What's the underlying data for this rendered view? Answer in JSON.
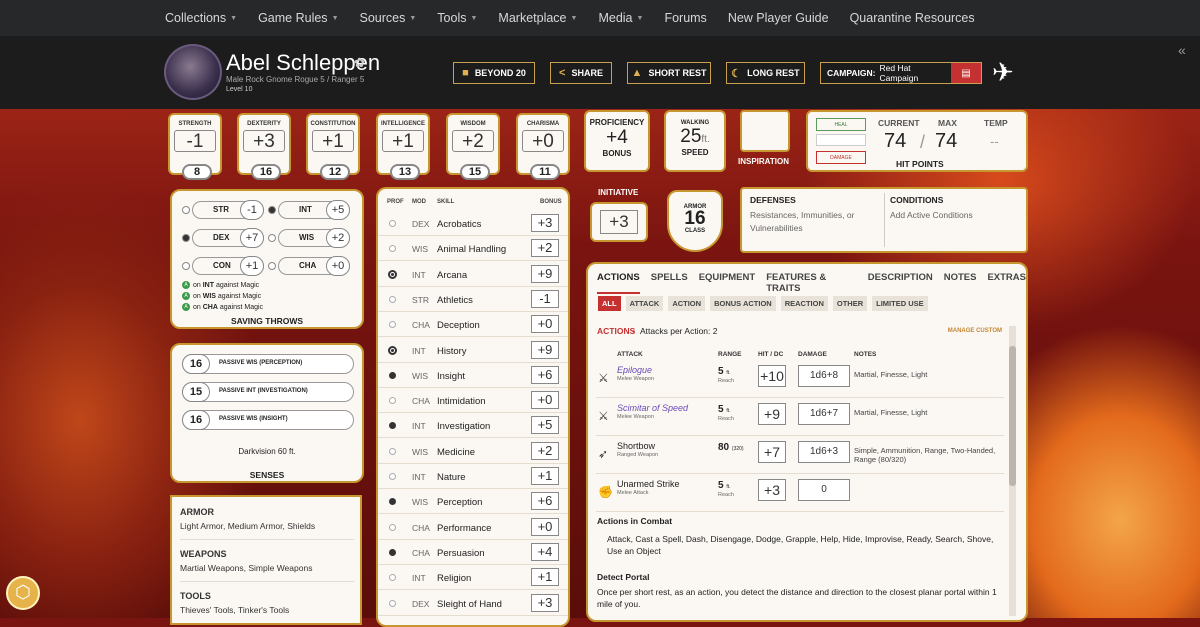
{
  "nav": [
    "Collections",
    "Game Rules",
    "Sources",
    "Tools",
    "Marketplace",
    "Media",
    "Forums",
    "New Player Guide",
    "Quarantine Resources"
  ],
  "nav_caret": [
    true,
    true,
    true,
    true,
    true,
    true,
    false,
    false,
    false
  ],
  "character": {
    "name": "Abel Schleppen",
    "subtitle": "Male  Rock Gnome  Rogue 5 / Ranger 5",
    "level": "Level 10"
  },
  "header_buttons": {
    "beyond20": "BEYOND 20",
    "share": "SHARE",
    "short_rest": "SHORT REST",
    "long_rest": "LONG REST"
  },
  "campaign": {
    "label": "CAMPAIGN:",
    "value": "Red Hat Campaign"
  },
  "abilities": [
    {
      "name": "STRENGTH",
      "mod": "-1",
      "score": "8"
    },
    {
      "name": "DEXTERITY",
      "mod": "+3",
      "score": "16"
    },
    {
      "name": "CONSTITUTION",
      "mod": "+1",
      "score": "12"
    },
    {
      "name": "INTELLIGENCE",
      "mod": "+1",
      "score": "13"
    },
    {
      "name": "WISDOM",
      "mod": "+2",
      "score": "15"
    },
    {
      "name": "CHARISMA",
      "mod": "+0",
      "score": "11"
    }
  ],
  "proficiency": {
    "label": "PROFICIENCY",
    "value": "+4",
    "sub": "BONUS"
  },
  "speed": {
    "label": "WALKING",
    "value": "25",
    "unit": "ft.",
    "sub": "SPEED"
  },
  "inspiration": "INSPIRATION",
  "hp": {
    "heal": "HEAL",
    "damage": "DAMAGE",
    "current_label": "CURRENT",
    "max_label": "MAX",
    "temp_label": "TEMP",
    "current": "74",
    "max": "74",
    "temp": "--",
    "title": "HIT POINTS"
  },
  "saves": [
    {
      "abbr": "STR",
      "val": "-1",
      "prof": false
    },
    {
      "abbr": "INT",
      "val": "+5",
      "prof": true
    },
    {
      "abbr": "DEX",
      "val": "+7",
      "prof": true
    },
    {
      "abbr": "WIS",
      "val": "+2",
      "prof": false
    },
    {
      "abbr": "CON",
      "val": "+1",
      "prof": false
    },
    {
      "abbr": "CHA",
      "val": "+0",
      "prof": false
    }
  ],
  "save_adv": [
    {
      "pre": "on ",
      "stat": "INT",
      "post": " against Magic"
    },
    {
      "pre": "on ",
      "stat": "WIS",
      "post": " against Magic"
    },
    {
      "pre": "on ",
      "stat": "CHA",
      "post": " against Magic"
    }
  ],
  "saving_throws_title": "SAVING THROWS",
  "senses": [
    {
      "val": "16",
      "label": "PASSIVE WIS (PERCEPTION)"
    },
    {
      "val": "15",
      "label": "PASSIVE INT (INVESTIGATION)"
    },
    {
      "val": "16",
      "label": "PASSIVE WIS (INSIGHT)"
    }
  ],
  "darkvision": "Darkvision 60 ft.",
  "senses_title": "SENSES",
  "proficiencies": [
    {
      "head": "ARMOR",
      "text": "Light Armor, Medium Armor, Shields"
    },
    {
      "head": "WEAPONS",
      "text": "Martial Weapons, Simple Weapons"
    },
    {
      "head": "TOOLS",
      "text": "Thieves' Tools, Tinker's Tools"
    }
  ],
  "skills_header": {
    "prof": "PROF",
    "mod": "MOD",
    "skill": "SKILL",
    "bonus": "BONUS"
  },
  "skills": [
    {
      "mod": "DEX",
      "name": "Acrobatics",
      "bonus": "+3",
      "prof": "none"
    },
    {
      "mod": "WIS",
      "name": "Animal Handling",
      "bonus": "+2",
      "prof": "none"
    },
    {
      "mod": "INT",
      "name": "Arcana",
      "bonus": "+9",
      "prof": "expert"
    },
    {
      "mod": "STR",
      "name": "Athletics",
      "bonus": "-1",
      "prof": "none"
    },
    {
      "mod": "CHA",
      "name": "Deception",
      "bonus": "+0",
      "prof": "none"
    },
    {
      "mod": "INT",
      "name": "History",
      "bonus": "+9",
      "prof": "expert"
    },
    {
      "mod": "WIS",
      "name": "Insight",
      "bonus": "+6",
      "prof": "prof"
    },
    {
      "mod": "CHA",
      "name": "Intimidation",
      "bonus": "+0",
      "prof": "none"
    },
    {
      "mod": "INT",
      "name": "Investigation",
      "bonus": "+5",
      "prof": "prof"
    },
    {
      "mod": "WIS",
      "name": "Medicine",
      "bonus": "+2",
      "prof": "none"
    },
    {
      "mod": "INT",
      "name": "Nature",
      "bonus": "+1",
      "prof": "none"
    },
    {
      "mod": "WIS",
      "name": "Perception",
      "bonus": "+6",
      "prof": "prof"
    },
    {
      "mod": "CHA",
      "name": "Performance",
      "bonus": "+0",
      "prof": "none"
    },
    {
      "mod": "CHA",
      "name": "Persuasion",
      "bonus": "+4",
      "prof": "prof"
    },
    {
      "mod": "INT",
      "name": "Religion",
      "bonus": "+1",
      "prof": "none"
    },
    {
      "mod": "DEX",
      "name": "Sleight of Hand",
      "bonus": "+3",
      "prof": "none"
    }
  ],
  "initiative": {
    "label": "INITIATIVE",
    "value": "+3"
  },
  "armor_class": {
    "top": "ARMOR",
    "value": "16",
    "bottom": "CLASS"
  },
  "defenses": {
    "title": "DEFENSES",
    "text": "Resistances, Immunities, or Vulnerabilities"
  },
  "conditions": {
    "title": "CONDITIONS",
    "text": "Add Active Conditions"
  },
  "tabs": [
    "ACTIONS",
    "SPELLS",
    "EQUIPMENT",
    "FEATURES & TRAITS",
    "DESCRIPTION",
    "NOTES",
    "EXTRAS"
  ],
  "subtabs": [
    "ALL",
    "ATTACK",
    "ACTION",
    "BONUS ACTION",
    "REACTION",
    "OTHER",
    "LIMITED USE"
  ],
  "actions_header": {
    "label": "ACTIONS",
    "sep": "•",
    "text": "Attacks per Action: 2",
    "manage": "MANAGE CUSTOM"
  },
  "attack_cols": {
    "attack": "ATTACK",
    "range": "RANGE",
    "hit": "HIT / DC",
    "damage": "DAMAGE",
    "notes": "NOTES"
  },
  "attacks": [
    {
      "name": "Epilogue",
      "type": "Melee Weapon",
      "range": "5",
      "unit": "ft.",
      "range_sub": "Reach",
      "hit": "+10",
      "damage": "1d6+8",
      "notes": "Martial, Finesse, Light",
      "magic": true,
      "icon": "⚔"
    },
    {
      "name": "Scimitar of Speed",
      "type": "Melee Weapon",
      "range": "5",
      "unit": "ft.",
      "range_sub": "Reach",
      "hit": "+9",
      "damage": "1d6+7",
      "notes": "Martial, Finesse, Light",
      "magic": true,
      "icon": "⚔"
    },
    {
      "name": "Shortbow",
      "type": "Ranged Weapon",
      "range": "80",
      "unit": "(320)",
      "range_sub": "",
      "hit": "+7",
      "damage": "1d6+3",
      "notes": "Simple, Ammunition, Range, Two-Handed, Range (80/320)",
      "magic": false,
      "icon": "➶"
    },
    {
      "name": "Unarmed Strike",
      "type": "Melee Attack",
      "range": "5",
      "unit": "ft.",
      "range_sub": "Reach",
      "hit": "+3",
      "damage": "0",
      "notes": "",
      "magic": false,
      "icon": "✊"
    }
  ],
  "combat": {
    "title": "Actions in Combat",
    "text": "Attack, Cast a Spell, Dash, Disengage, Dodge, Grapple, Help, Hide, Improvise, Ready, Search, Shove, Use an Object"
  },
  "portal": {
    "title": "Detect Portal",
    "text": "Once per short rest, as an action, you detect the distance and direction to the closest planar portal within 1 mile of you."
  },
  "colors": {
    "accent": "#c53131",
    "border": "#c6962f",
    "parchment": "#fbf8f3",
    "nav": "#26282a"
  }
}
